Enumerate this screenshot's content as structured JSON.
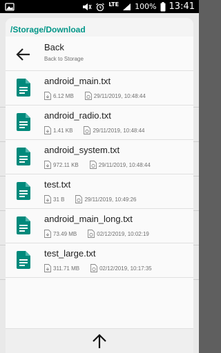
{
  "status_bar": {
    "battery": "100%",
    "time": "13:41",
    "network": "LTE"
  },
  "dialog": {
    "path": "/Storage/Download",
    "back": {
      "label": "Back",
      "sublabel": "Back to Storage"
    },
    "files": [
      {
        "name": "android_main.txt",
        "size": "6.12 MB",
        "date": "29/11/2019, 10:48:44"
      },
      {
        "name": "android_radio.txt",
        "size": "1.41 KB",
        "date": "29/11/2019, 10:48:44"
      },
      {
        "name": "android_system.txt",
        "size": "972.11 KB",
        "date": "29/11/2019, 10:48:44"
      },
      {
        "name": "test.txt",
        "size": "31 B",
        "date": "29/11/2019, 10:49:26"
      },
      {
        "name": "android_main_long.txt",
        "size": "73.49 MB",
        "date": "02/12/2019, 10:02:19"
      },
      {
        "name": "test_large.txt",
        "size": "311.71 MB",
        "date": "02/12/2019, 10:17:35"
      }
    ]
  },
  "colors": {
    "accent": "#009688",
    "icon": "#00897b"
  }
}
